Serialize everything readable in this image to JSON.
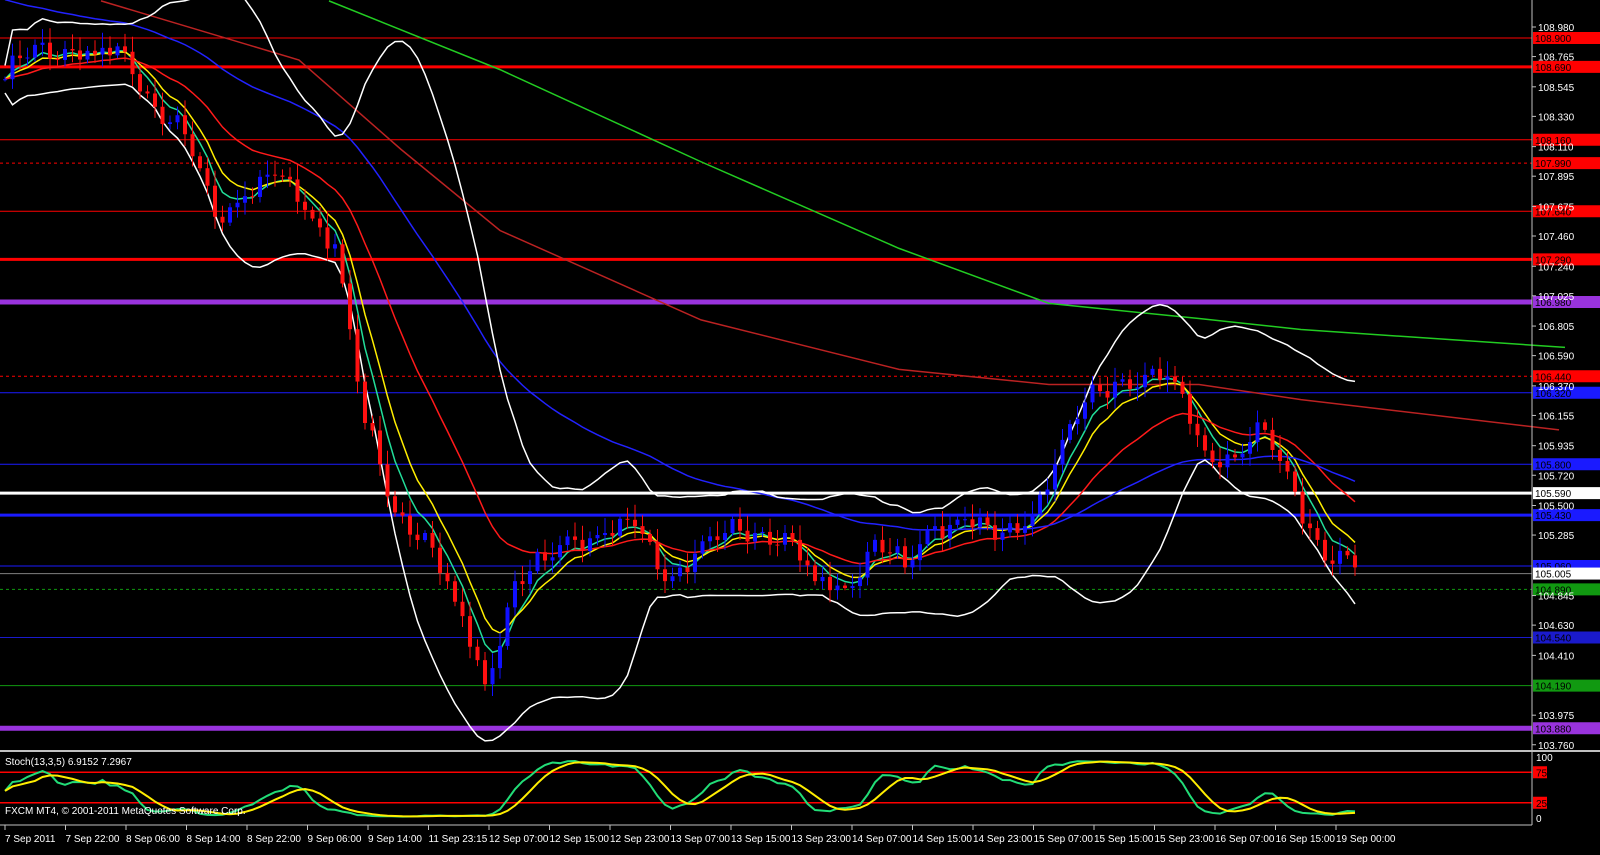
{
  "window": {
    "copyright": "FXCM MT4, © 2001-2011 MetaQuotes Software Corp."
  },
  "colors": {
    "bull": "#1010ff",
    "bear": "#ff1010",
    "axis": "#c0c0c0",
    "text": "#ffffff"
  },
  "chart_data": [
    {
      "type": "candlestick",
      "title": "",
      "price_range": [
        103.76,
        108.98
      ],
      "y_ticks": [
        "108.980",
        "108.765",
        "108.545",
        "108.330",
        "108.110",
        "107.895",
        "107.675",
        "107.460",
        "107.240",
        "107.025",
        "106.805",
        "106.590",
        "106.370",
        "106.155",
        "105.935",
        "105.720",
        "105.500",
        "105.285",
        "104.845",
        "104.630",
        "104.410",
        "103.975",
        "103.760"
      ],
      "x_ticks": [
        "7 Sep 2011",
        "7 Sep 22:00",
        "8 Sep 06:00",
        "8 Sep 14:00",
        "8 Sep 22:00",
        "9 Sep 06:00",
        "9 Sep 14:00",
        "11 Sep 23:15",
        "12 Sep 07:00",
        "12 Sep 15:00",
        "12 Sep 23:00",
        "13 Sep 07:00",
        "13 Sep 15:00",
        "13 Sep 23:00",
        "14 Sep 07:00",
        "14 Sep 15:00",
        "14 Sep 23:00",
        "15 Sep 07:00",
        "15 Sep 15:00",
        "15 Sep 23:00",
        "16 Sep 07:00",
        "16 Sep 15:00",
        "19 Sep 00:00"
      ],
      "bars_per_sample": 4,
      "closes": [
        108.6,
        108.85,
        108.82,
        108.78,
        108.8,
        108.4,
        108.2,
        107.6,
        107.75,
        107.9,
        107.65,
        107.4,
        106.1,
        105.45,
        105.3,
        104.8,
        104.2,
        104.95,
        105.1,
        105.25,
        105.3,
        105.35,
        104.95,
        105.15,
        105.3,
        105.3,
        105.3,
        104.95,
        104.9,
        105.25,
        105.05,
        105.35,
        105.4,
        105.25,
        105.35,
        105.8,
        106.25,
        106.4,
        106.45,
        106.4,
        105.9,
        105.85,
        106.05,
        105.6,
        105.1,
        105.05
      ],
      "current_price": {
        "value": 105.005,
        "label": "105.005"
      },
      "levels": [
        {
          "price": 108.9,
          "label": "108.900",
          "color": "#ff0000",
          "style": "solid",
          "kind": "thin"
        },
        {
          "price": 108.69,
          "label": "108.690",
          "color": "#ff0000",
          "style": "solid",
          "kind": "thick"
        },
        {
          "price": 108.16,
          "label": "108.160",
          "color": "#ff0000",
          "style": "solid",
          "kind": "thin"
        },
        {
          "price": 107.99,
          "label": "107.990",
          "color": "#ff0000",
          "style": "dashed",
          "kind": "thin"
        },
        {
          "price": 107.64,
          "label": "107.640",
          "color": "#ff0000",
          "style": "solid",
          "kind": "thin"
        },
        {
          "price": 107.29,
          "label": "107.290",
          "color": "#ff0000",
          "style": "solid",
          "kind": "thick"
        },
        {
          "price": 106.98,
          "label": "106.980",
          "color": "#9933dd",
          "style": "solid",
          "kind": "heavy"
        },
        {
          "price": 106.44,
          "label": "106.440",
          "color": "#ff0000",
          "style": "dashed",
          "kind": "thin"
        },
        {
          "price": 106.32,
          "label": "106.320",
          "color": "#1a1aff",
          "style": "solid",
          "kind": "thin"
        },
        {
          "price": 105.8,
          "label": "105.800",
          "color": "#1a1aff",
          "style": "solid",
          "kind": "thin"
        },
        {
          "price": 105.59,
          "label": "105.590",
          "color": "#ffffff",
          "style": "solid",
          "kind": "thick"
        },
        {
          "price": 105.43,
          "label": "105.430",
          "color": "#1a1aff",
          "style": "solid",
          "kind": "thick"
        },
        {
          "price": 105.06,
          "label": "105.060",
          "color": "#1a1aff",
          "style": "solid",
          "kind": "thin"
        },
        {
          "price": 104.89,
          "label": "104.890",
          "color": "#119911",
          "style": "dashed",
          "kind": "thin"
        },
        {
          "price": 104.54,
          "label": "104.540",
          "color": "#1a1acc",
          "style": "solid",
          "kind": "thin"
        },
        {
          "price": 104.19,
          "label": "104.190",
          "color": "#119911",
          "style": "solid",
          "kind": "thin"
        },
        {
          "price": 103.88,
          "label": "103.880",
          "color": "#9933dd",
          "style": "solid",
          "kind": "heavy"
        }
      ],
      "moving_averages": [
        {
          "name": "EMA5",
          "period": 5,
          "color": "#22dd99"
        },
        {
          "name": "EMA8",
          "period": 8,
          "color": "#ffee00"
        },
        {
          "name": "EMA21",
          "period": 21,
          "color": "#ff1a1a"
        },
        {
          "name": "EMA55",
          "period": 55,
          "color": "#2222ff"
        }
      ],
      "long_mas": [
        {
          "name": "long-red",
          "color": "#bb2222",
          "points": [
            [
              3.2,
              109.17
            ],
            [
              9.8,
              108.74
            ],
            [
              13.2,
              108.09
            ],
            [
              16.5,
              107.5
            ],
            [
              23.2,
              106.85
            ],
            [
              29.8,
              106.49
            ],
            [
              34.8,
              106.38
            ],
            [
              39.8,
              106.38
            ],
            [
              43.2,
              106.27
            ],
            [
              51.8,
              106.05
            ]
          ]
        },
        {
          "name": "long-green",
          "color": "#22cc22",
          "points": [
            [
              10.8,
              109.17
            ],
            [
              16.5,
              108.67
            ],
            [
              23.2,
              108.0
            ],
            [
              29.8,
              107.37
            ],
            [
              34.8,
              106.97
            ],
            [
              39.8,
              106.86
            ],
            [
              43.2,
              106.78
            ],
            [
              52,
              106.65
            ]
          ]
        }
      ],
      "bollinger": {
        "period": 20,
        "deviation": 2,
        "color": "#ffffff"
      }
    },
    {
      "type": "line",
      "title": "Stoch(13,3,5) 6.9152 7.2967",
      "y_range": [
        0,
        100
      ],
      "y_ticks": [
        "100",
        "75",
        "25",
        "0"
      ],
      "levels": [
        75,
        25
      ],
      "series": [
        {
          "name": "%K",
          "color": "#22dd77"
        },
        {
          "name": "%D",
          "color": "#ffee00"
        }
      ]
    }
  ]
}
